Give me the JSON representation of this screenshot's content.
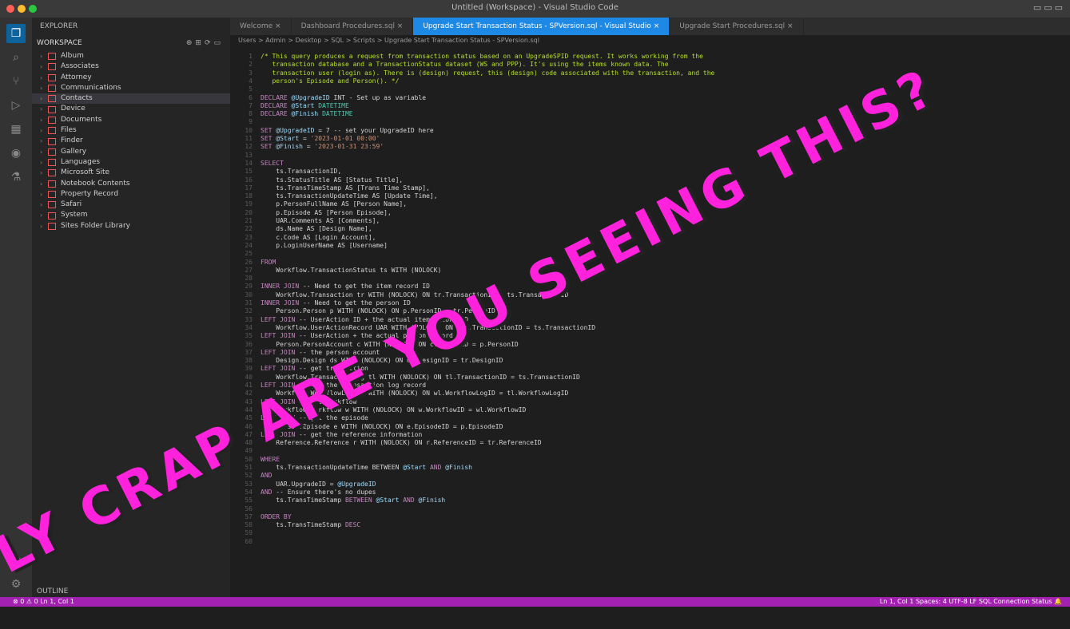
{
  "window": {
    "title": "Untitled (Workspace) - Visual Studio Code"
  },
  "activity_bar": {
    "items": [
      {
        "name": "explorer",
        "glyph": "❐"
      },
      {
        "name": "search",
        "glyph": "⌕"
      },
      {
        "name": "source-control",
        "glyph": "⑂"
      },
      {
        "name": "run",
        "glyph": "▷"
      },
      {
        "name": "extensions",
        "glyph": "▦"
      },
      {
        "name": "remote",
        "glyph": "◉"
      },
      {
        "name": "testing",
        "glyph": "⚗"
      }
    ],
    "bottom": [
      {
        "name": "account",
        "glyph": "◯"
      },
      {
        "name": "settings",
        "glyph": "⚙"
      }
    ]
  },
  "sidebar": {
    "header": "EXPLORER",
    "section": "WORKSPACE",
    "section_icons": "⊕⊞⟳▭",
    "items": [
      "Album",
      "Associates",
      "Attorney",
      "Communications",
      "Contacts",
      "Device",
      "Documents",
      "Files",
      "Finder",
      "Gallery",
      "Languages",
      "Microsoft Site",
      "Notebook Contents",
      "Property Record",
      "Safari",
      "System",
      "Sites Folder Library"
    ],
    "selected_index": 4,
    "outline": "OUTLINE"
  },
  "tabs": [
    "Welcome",
    "Dashboard Procedures.sql",
    "Upgrade Start Transaction Status - SPVersion.sql - Visual Studio",
    "Upgrade Start Procedures.sql"
  ],
  "active_tab": 2,
  "breadcrumb": "Users > Admin > Desktop > SQL > Scripts > Upgrade Start Transaction Status - SPVersion.sql",
  "code": {
    "lines": [
      [
        {
          "c": "t-com",
          "t": "/* This query produces a request from transaction status based on an UpgradeSPID request. It works working from the"
        }
      ],
      [
        {
          "c": "t-com",
          "t": "   transaction database and a TransactionStatus dataset (WS and PPP). It's using the items known data. The"
        }
      ],
      [
        {
          "c": "t-com",
          "t": "   transaction user (login as). There is (design) request, this (design) code associated with the transaction, and the"
        }
      ],
      [
        {
          "c": "t-com",
          "t": "   person's Episode and Person(). */"
        }
      ],
      [],
      [
        {
          "c": "t-key",
          "t": "DECLARE"
        },
        {
          "c": "t-ident",
          "t": " @UpgradeID"
        },
        {
          "c": "t-txt",
          "t": " INT - Set up as variable"
        }
      ],
      [
        {
          "c": "t-key",
          "t": "DECLARE"
        },
        {
          "c": "t-ident",
          "t": " @Start"
        },
        {
          "c": "t-type",
          "t": " DATETIME"
        }
      ],
      [
        {
          "c": "t-key",
          "t": "DECLARE"
        },
        {
          "c": "t-ident",
          "t": " @Finish"
        },
        {
          "c": "t-type",
          "t": " DATETIME"
        }
      ],
      [],
      [
        {
          "c": "t-key",
          "t": "SET"
        },
        {
          "c": "t-ident",
          "t": " @UpgradeID"
        },
        {
          "c": "t-txt",
          "t": " = 7 -- set your UpgradeID here"
        }
      ],
      [
        {
          "c": "t-key",
          "t": "SET"
        },
        {
          "c": "t-ident",
          "t": " @Start"
        },
        {
          "c": "t-txt",
          "t": " = "
        },
        {
          "c": "t-str",
          "t": "'2023-01-01 00:00'"
        }
      ],
      [
        {
          "c": "t-key",
          "t": "SET"
        },
        {
          "c": "t-ident",
          "t": " @Finish"
        },
        {
          "c": "t-txt",
          "t": " = "
        },
        {
          "c": "t-str",
          "t": "'2023-01-31 23:59'"
        }
      ],
      [],
      [
        {
          "c": "t-key",
          "t": "SELECT"
        }
      ],
      [
        {
          "c": "t-txt",
          "t": "    ts.TransactionID,"
        }
      ],
      [
        {
          "c": "t-txt",
          "t": "    ts.StatusTitle AS [Status Title],"
        }
      ],
      [
        {
          "c": "t-txt",
          "t": "    ts.TransTimeStamp AS [Trans Time Stamp],"
        }
      ],
      [
        {
          "c": "t-txt",
          "t": "    ts.TransactionUpdateTime AS [Update Time],"
        }
      ],
      [
        {
          "c": "t-txt",
          "t": "    p.PersonFullName AS [Person Name],"
        }
      ],
      [
        {
          "c": "t-txt",
          "t": "    p.Episode AS [Person Episode],"
        }
      ],
      [
        {
          "c": "t-txt",
          "t": "    UAR.Comments AS [Comments],"
        }
      ],
      [
        {
          "c": "t-txt",
          "t": "    ds.Name AS [Design Name],"
        }
      ],
      [
        {
          "c": "t-txt",
          "t": "    c.Code AS [Login Account],"
        }
      ],
      [
        {
          "c": "t-txt",
          "t": "    p.LoginUserName AS [Username]"
        }
      ],
      [],
      [
        {
          "c": "t-key",
          "t": "FROM"
        }
      ],
      [
        {
          "c": "t-txt",
          "t": "    Workflow.TransactionStatus ts WITH (NOLOCK)"
        }
      ],
      [],
      [
        {
          "c": "t-key",
          "t": "INNER JOIN"
        },
        {
          "c": "t-txt",
          "t": " -- Need to get the item record ID"
        }
      ],
      [
        {
          "c": "t-txt",
          "t": "    Workflow.Transaction tr WITH (NOLOCK) ON tr.TransactionID = ts.TransactionID"
        }
      ],
      [
        {
          "c": "t-key",
          "t": "INNER JOIN"
        },
        {
          "c": "t-txt",
          "t": " -- Need to get the person ID"
        }
      ],
      [
        {
          "c": "t-txt",
          "t": "    Person.Person p WITH (NOLOCK) ON p.PersonID = tr.PersonID"
        }
      ],
      [
        {
          "c": "t-key",
          "t": "LEFT JOIN"
        },
        {
          "c": "t-txt",
          "t": " -- UserAction ID + the actual item record ID"
        }
      ],
      [
        {
          "c": "t-txt",
          "t": "    Workflow.UserActionRecord UAR WITH (NOLOCK) ON UAR.TransactionID = ts.TransactionID"
        }
      ],
      [
        {
          "c": "t-key",
          "t": "LEFT JOIN"
        },
        {
          "c": "t-txt",
          "t": " -- UserAction + the actual person record"
        }
      ],
      [
        {
          "c": "t-txt",
          "t": "    Person.PersonAccount c WITH (NOLOCK) ON c.PersonID = p.PersonID"
        }
      ],
      [
        {
          "c": "t-key",
          "t": "LEFT JOIN"
        },
        {
          "c": "t-txt",
          "t": " -- the person account"
        }
      ],
      [
        {
          "c": "t-txt",
          "t": "    Design.Design ds WITH (NOLOCK) ON ds.DesignID = tr.DesignID"
        }
      ],
      [
        {
          "c": "t-key",
          "t": "LEFT JOIN"
        },
        {
          "c": "t-txt",
          "t": " -- get transaction"
        }
      ],
      [
        {
          "c": "t-txt",
          "t": "    Workflow.TransactionLog tl WITH (NOLOCK) ON tl.TransactionID = ts.TransactionID"
        }
      ],
      [
        {
          "c": "t-key",
          "t": "LEFT JOIN"
        },
        {
          "c": "t-txt",
          "t": " -- get the transaction log record"
        }
      ],
      [
        {
          "c": "t-txt",
          "t": "    Workflow.WorkflowLog wl WITH (NOLOCK) ON wl.WorkflowLogID = tl.WorkflowLogID"
        }
      ],
      [
        {
          "c": "t-key",
          "t": "LEFT JOIN"
        },
        {
          "c": "t-txt",
          "t": " -- get workflow"
        }
      ],
      [
        {
          "c": "t-txt",
          "t": "    Workflow.Workflow w WITH (NOLOCK) ON w.WorkflowID = wl.WorkflowID"
        }
      ],
      [
        {
          "c": "t-key",
          "t": "LEFT JOIN"
        },
        {
          "c": "t-txt",
          "t": " -- get the episode"
        }
      ],
      [
        {
          "c": "t-txt",
          "t": "    Person.Episode e WITH (NOLOCK) ON e.EpisodeID = p.EpisodeID"
        }
      ],
      [
        {
          "c": "t-key",
          "t": "LEFT JOIN"
        },
        {
          "c": "t-txt",
          "t": " -- get the reference information"
        }
      ],
      [
        {
          "c": "t-txt",
          "t": "    Reference.Reference r WITH (NOLOCK) ON r.ReferenceID = tr.ReferenceID"
        }
      ],
      [],
      [
        {
          "c": "t-key",
          "t": "WHERE"
        }
      ],
      [
        {
          "c": "t-txt",
          "t": "    ts.TransactionUpdateTime BETWEEN "
        },
        {
          "c": "t-ident",
          "t": "@Start"
        },
        {
          "c": "t-key",
          "t": " AND "
        },
        {
          "c": "t-ident",
          "t": "@Finish"
        }
      ],
      [
        {
          "c": "t-key",
          "t": "AND"
        }
      ],
      [
        {
          "c": "t-txt",
          "t": "    UAR.UpgradeID = "
        },
        {
          "c": "t-ident",
          "t": "@UpgradeID"
        }
      ],
      [
        {
          "c": "t-key",
          "t": "AND"
        },
        {
          "c": "t-txt",
          "t": " -- Ensure there's no dupes"
        }
      ],
      [
        {
          "c": "t-txt",
          "t": "    ts.TransTimeStamp "
        },
        {
          "c": "t-key",
          "t": "BETWEEN "
        },
        {
          "c": "t-ident",
          "t": "@Start"
        },
        {
          "c": "t-key",
          "t": " AND "
        },
        {
          "c": "t-ident",
          "t": "@Finish"
        }
      ],
      [],
      [
        {
          "c": "t-key",
          "t": "ORDER BY"
        }
      ],
      [
        {
          "c": "t-txt",
          "t": "    ts.TransTimeStamp "
        },
        {
          "c": "t-key",
          "t": "DESC"
        }
      ],
      [],
      []
    ]
  },
  "overlay_text": "HOLY CRAP ARE YOU SEEING THIS?",
  "statusbar": {
    "left": "⊗ 0 ⚠ 0   Ln 1, Col 1",
    "right": "Ln 1, Col 1   Spaces: 4   UTF-8   LF   SQL   Connection Status   🔔"
  },
  "colors": {
    "overlay": "#ff22dd",
    "statusbar": "#a321b0",
    "active_tab": "#1e88e5",
    "comment": "#b5e02e"
  }
}
